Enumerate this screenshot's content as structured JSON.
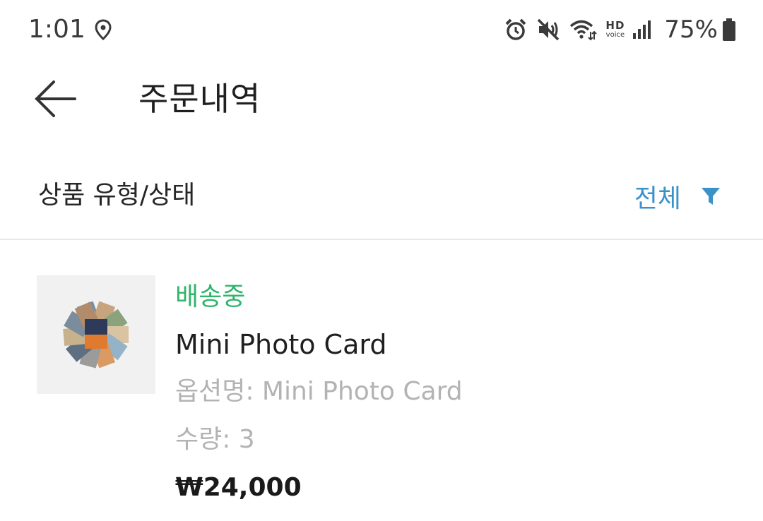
{
  "status_bar": {
    "time": "1:01",
    "hd_text": "HD",
    "voice_text": "voice",
    "battery_percent": "75%",
    "icons": [
      "location-icon",
      "alarm-icon",
      "mute-icon",
      "wifi-icon",
      "hd-voice-icon",
      "signal-icon",
      "battery-icon"
    ]
  },
  "header": {
    "back_icon": "arrow-left-icon",
    "title": "주문내역"
  },
  "filter": {
    "label": "상품 유형/상태",
    "value": "전체",
    "icon": "filter-icon",
    "accent_color": "#3a92c8"
  },
  "orders": [
    {
      "status": "배송중",
      "status_color": "#2fb56b",
      "product_name": "Mini Photo Card",
      "option": "옵션명: Mini Photo Card",
      "quantity": "수량: 3",
      "price": "₩24,000"
    }
  ]
}
